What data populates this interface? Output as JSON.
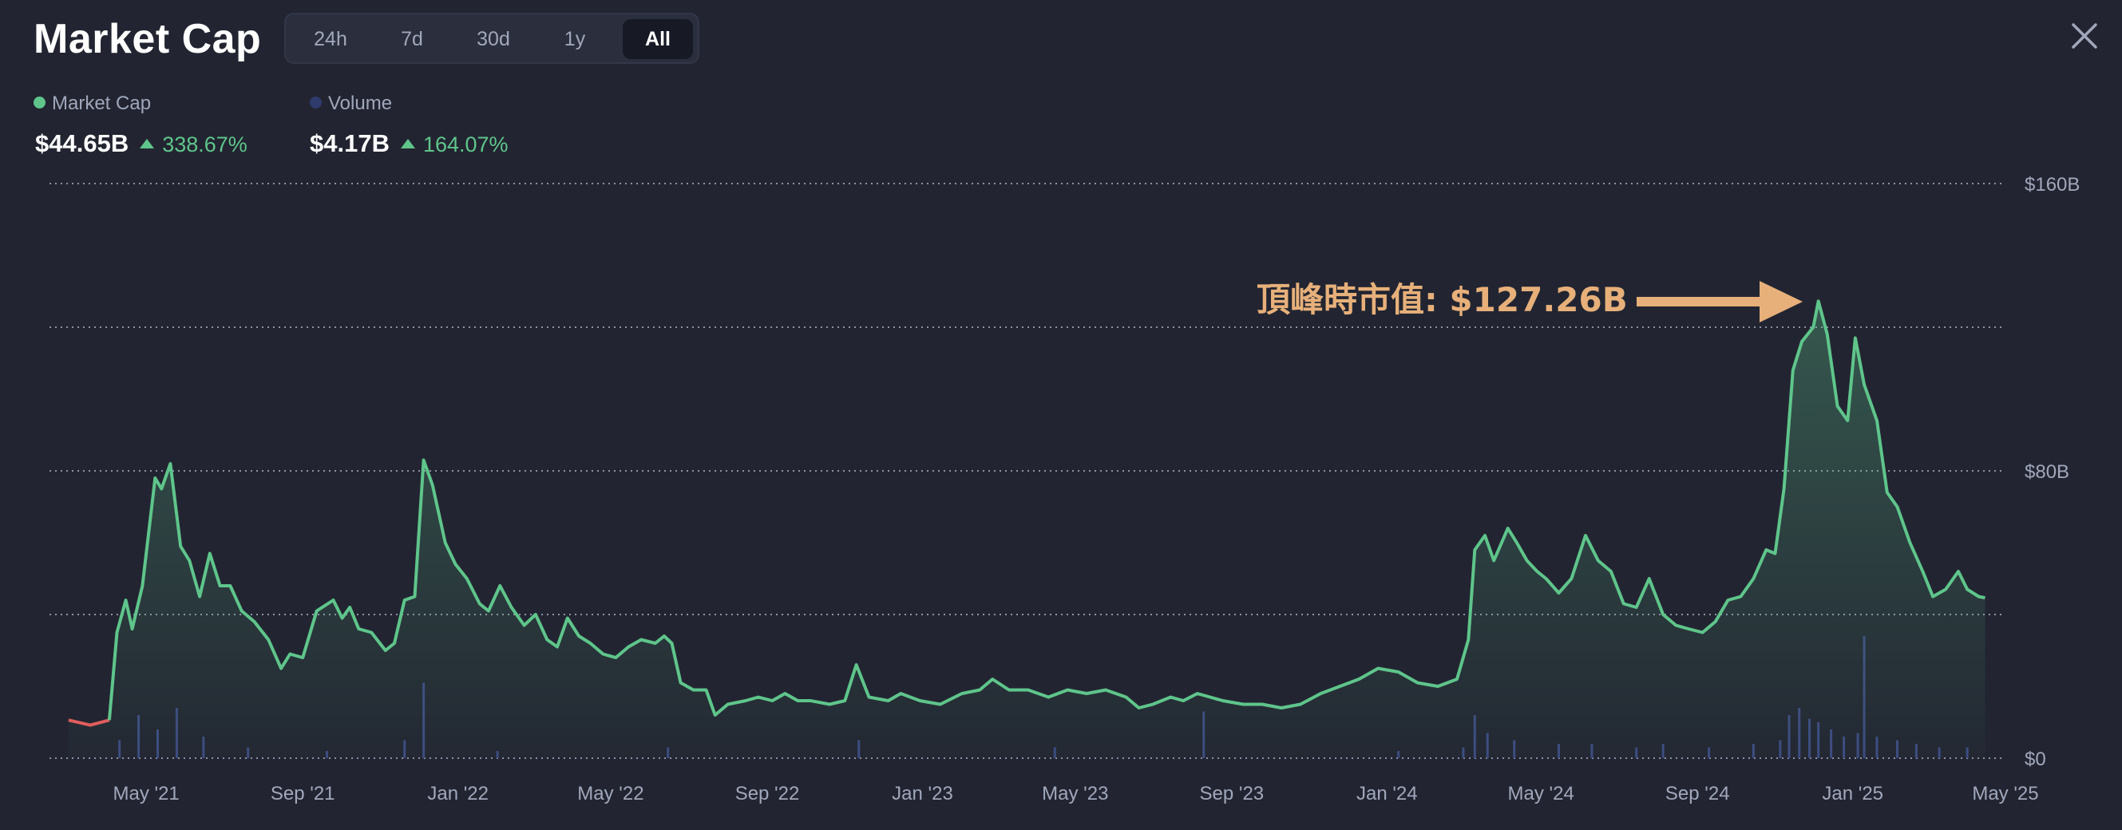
{
  "header": {
    "title": "Market Cap",
    "tabs": [
      {
        "label": "24h",
        "active": false
      },
      {
        "label": "7d",
        "active": false
      },
      {
        "label": "30d",
        "active": false
      },
      {
        "label": "1y",
        "active": false
      },
      {
        "label": "All",
        "active": true
      }
    ],
    "close_icon": "close-icon"
  },
  "legend": {
    "market_cap": {
      "label": "Market Cap",
      "value": "$44.65B",
      "change": "338.67%",
      "color": "#5fc58b"
    },
    "volume": {
      "label": "Volume",
      "value": "$4.17B",
      "change": "164.07%",
      "color": "#2e3b6b"
    }
  },
  "colors": {
    "background": "#222531",
    "line_up": "#5fc58b",
    "line_down": "#e05d5d",
    "volume_bar": "#3c4a80",
    "annotation": "#e7b07a",
    "axis_text": "#a1a7bb"
  },
  "chart_data": {
    "type": "area",
    "title": "",
    "xlabel": "",
    "ylabel": "",
    "x_tick_labels": [
      "May '21",
      "Sep '21",
      "Jan '22",
      "May '22",
      "Sep '22",
      "Jan '23",
      "May '23",
      "Sep '23",
      "Jan '24",
      "May '24",
      "Sep '24",
      "Jan '25",
      "May '25"
    ],
    "y_tick_labels": [
      "$160B",
      "$80B",
      "$0"
    ],
    "ylim": [
      0,
      160
    ],
    "grid": true,
    "legend_placement": "top-left",
    "annotation": {
      "text": "頂峰時市值: $127.26B",
      "x": "2024-12-05",
      "y": 127.26
    },
    "series": [
      {
        "name": "Market Cap",
        "unit": "B USD",
        "points": [
          [
            "2021-03-01",
            10.6
          ],
          [
            "2021-03-18",
            9.2
          ],
          [
            "2021-04-02",
            10.6
          ],
          [
            "2021-04-08",
            35
          ],
          [
            "2021-04-15",
            44
          ],
          [
            "2021-04-20",
            36
          ],
          [
            "2021-04-28",
            48
          ],
          [
            "2021-05-08",
            78
          ],
          [
            "2021-05-13",
            75
          ],
          [
            "2021-05-20",
            82
          ],
          [
            "2021-05-28",
            59
          ],
          [
            "2021-06-04",
            55
          ],
          [
            "2021-06-12",
            45
          ],
          [
            "2021-06-20",
            57
          ],
          [
            "2021-06-28",
            48
          ],
          [
            "2021-07-06",
            48
          ],
          [
            "2021-07-15",
            41
          ],
          [
            "2021-07-25",
            38
          ],
          [
            "2021-08-05",
            33
          ],
          [
            "2021-08-15",
            25
          ],
          [
            "2021-08-22",
            29
          ],
          [
            "2021-09-01",
            28
          ],
          [
            "2021-09-12",
            41
          ],
          [
            "2021-09-25",
            44
          ],
          [
            "2021-10-02",
            39
          ],
          [
            "2021-10-08",
            42
          ],
          [
            "2021-10-15",
            36
          ],
          [
            "2021-10-25",
            35
          ],
          [
            "2021-11-05",
            30
          ],
          [
            "2021-11-12",
            32
          ],
          [
            "2021-11-20",
            44
          ],
          [
            "2021-11-28",
            45
          ],
          [
            "2021-12-05",
            83
          ],
          [
            "2021-12-12",
            76
          ],
          [
            "2021-12-22",
            60
          ],
          [
            "2021-12-30",
            54
          ],
          [
            "2022-01-08",
            50
          ],
          [
            "2022-01-18",
            43
          ],
          [
            "2022-01-25",
            41
          ],
          [
            "2022-02-03",
            48
          ],
          [
            "2022-02-12",
            42
          ],
          [
            "2022-02-22",
            37
          ],
          [
            "2022-03-03",
            40
          ],
          [
            "2022-03-12",
            33
          ],
          [
            "2022-03-20",
            31
          ],
          [
            "2022-03-28",
            39
          ],
          [
            "2022-04-06",
            34
          ],
          [
            "2022-04-15",
            32
          ],
          [
            "2022-04-25",
            29
          ],
          [
            "2022-05-05",
            28
          ],
          [
            "2022-05-15",
            31
          ],
          [
            "2022-05-25",
            33
          ],
          [
            "2022-06-05",
            32
          ],
          [
            "2022-06-12",
            34
          ],
          [
            "2022-06-18",
            32
          ],
          [
            "2022-06-25",
            21
          ],
          [
            "2022-07-05",
            19
          ],
          [
            "2022-07-15",
            19
          ],
          [
            "2022-07-22",
            12
          ],
          [
            "2022-08-01",
            15
          ],
          [
            "2022-08-15",
            16
          ],
          [
            "2022-08-25",
            17
          ],
          [
            "2022-09-05",
            16
          ],
          [
            "2022-09-15",
            18
          ],
          [
            "2022-09-25",
            16
          ],
          [
            "2022-10-05",
            16
          ],
          [
            "2022-10-20",
            15
          ],
          [
            "2022-11-01",
            16
          ],
          [
            "2022-11-10",
            26
          ],
          [
            "2022-11-20",
            17
          ],
          [
            "2022-12-05",
            16
          ],
          [
            "2022-12-15",
            18
          ],
          [
            "2022-12-30",
            16
          ],
          [
            "2023-01-15",
            15
          ],
          [
            "2023-02-01",
            18
          ],
          [
            "2023-02-15",
            19
          ],
          [
            "2023-02-25",
            22
          ],
          [
            "2023-03-10",
            19
          ],
          [
            "2023-03-25",
            19
          ],
          [
            "2023-04-10",
            17
          ],
          [
            "2023-04-25",
            19
          ],
          [
            "2023-05-10",
            18
          ],
          [
            "2023-05-25",
            19
          ],
          [
            "2023-06-10",
            17
          ],
          [
            "2023-06-20",
            14
          ],
          [
            "2023-07-01",
            15
          ],
          [
            "2023-07-15",
            17
          ],
          [
            "2023-07-25",
            16
          ],
          [
            "2023-08-05",
            18
          ],
          [
            "2023-08-15",
            17
          ],
          [
            "2023-08-25",
            16
          ],
          [
            "2023-09-10",
            15
          ],
          [
            "2023-09-25",
            15
          ],
          [
            "2023-10-10",
            14
          ],
          [
            "2023-10-25",
            15
          ],
          [
            "2023-11-10",
            18
          ],
          [
            "2023-11-25",
            20
          ],
          [
            "2023-12-10",
            22
          ],
          [
            "2023-12-25",
            25
          ],
          [
            "2024-01-10",
            24
          ],
          [
            "2024-01-25",
            21
          ],
          [
            "2024-02-10",
            20
          ],
          [
            "2024-02-25",
            22
          ],
          [
            "2024-03-05",
            33
          ],
          [
            "2024-03-10",
            58
          ],
          [
            "2024-03-18",
            62
          ],
          [
            "2024-03-25",
            55
          ],
          [
            "2024-04-05",
            64
          ],
          [
            "2024-04-12",
            60
          ],
          [
            "2024-04-20",
            55
          ],
          [
            "2024-04-28",
            52
          ],
          [
            "2024-05-05",
            50
          ],
          [
            "2024-05-15",
            46
          ],
          [
            "2024-05-25",
            50
          ],
          [
            "2024-06-05",
            62
          ],
          [
            "2024-06-15",
            55
          ],
          [
            "2024-06-25",
            52
          ],
          [
            "2024-07-05",
            43
          ],
          [
            "2024-07-15",
            42
          ],
          [
            "2024-07-25",
            50
          ],
          [
            "2024-08-05",
            40
          ],
          [
            "2024-08-15",
            37
          ],
          [
            "2024-08-25",
            36
          ],
          [
            "2024-09-05",
            35
          ],
          [
            "2024-09-15",
            38
          ],
          [
            "2024-09-25",
            44
          ],
          [
            "2024-10-05",
            45
          ],
          [
            "2024-10-15",
            50
          ],
          [
            "2024-10-25",
            58
          ],
          [
            "2024-11-01",
            57
          ],
          [
            "2024-11-08",
            75
          ],
          [
            "2024-11-15",
            108
          ],
          [
            "2024-11-22",
            116
          ],
          [
            "2024-12-01",
            120
          ],
          [
            "2024-12-05",
            127.26
          ],
          [
            "2024-12-12",
            118
          ],
          [
            "2024-12-20",
            98
          ],
          [
            "2024-12-28",
            94
          ],
          [
            "2025-01-03",
            117
          ],
          [
            "2025-01-10",
            104
          ],
          [
            "2025-01-20",
            94
          ],
          [
            "2025-01-28",
            74
          ],
          [
            "2025-02-05",
            70
          ],
          [
            "2025-02-15",
            60
          ],
          [
            "2025-02-25",
            52
          ],
          [
            "2025-03-05",
            45
          ],
          [
            "2025-03-15",
            47
          ],
          [
            "2025-03-25",
            52
          ],
          [
            "2025-04-01",
            47
          ],
          [
            "2025-04-10",
            45
          ],
          [
            "2025-04-15",
            44.65
          ]
        ]
      },
      {
        "name": "Volume",
        "unit": "B USD",
        "points": [
          [
            "2021-04-10",
            5
          ],
          [
            "2021-04-25",
            12
          ],
          [
            "2021-05-10",
            8
          ],
          [
            "2021-05-25",
            14
          ],
          [
            "2021-06-15",
            6
          ],
          [
            "2021-07-20",
            3
          ],
          [
            "2021-09-20",
            2
          ],
          [
            "2021-11-20",
            5
          ],
          [
            "2021-12-05",
            21
          ],
          [
            "2022-02-01",
            2
          ],
          [
            "2022-06-15",
            3
          ],
          [
            "2022-11-12",
            5
          ],
          [
            "2023-04-15",
            3
          ],
          [
            "2023-08-10",
            13
          ],
          [
            "2024-01-10",
            2
          ],
          [
            "2024-03-01",
            3
          ],
          [
            "2024-03-10",
            12
          ],
          [
            "2024-03-20",
            7
          ],
          [
            "2024-04-10",
            5
          ],
          [
            "2024-05-15",
            4
          ],
          [
            "2024-06-10",
            4
          ],
          [
            "2024-07-15",
            3
          ],
          [
            "2024-08-05",
            4
          ],
          [
            "2024-09-10",
            3
          ],
          [
            "2024-10-15",
            4
          ],
          [
            "2024-11-05",
            5
          ],
          [
            "2024-11-12",
            12
          ],
          [
            "2024-11-20",
            14
          ],
          [
            "2024-11-28",
            11
          ],
          [
            "2024-12-05",
            10
          ],
          [
            "2024-12-15",
            8
          ],
          [
            "2024-12-25",
            6
          ],
          [
            "2025-01-05",
            7
          ],
          [
            "2025-01-10",
            34
          ],
          [
            "2025-01-20",
            6
          ],
          [
            "2025-02-05",
            5
          ],
          [
            "2025-02-20",
            4
          ],
          [
            "2025-03-10",
            3
          ],
          [
            "2025-04-01",
            3
          ]
        ]
      }
    ]
  }
}
